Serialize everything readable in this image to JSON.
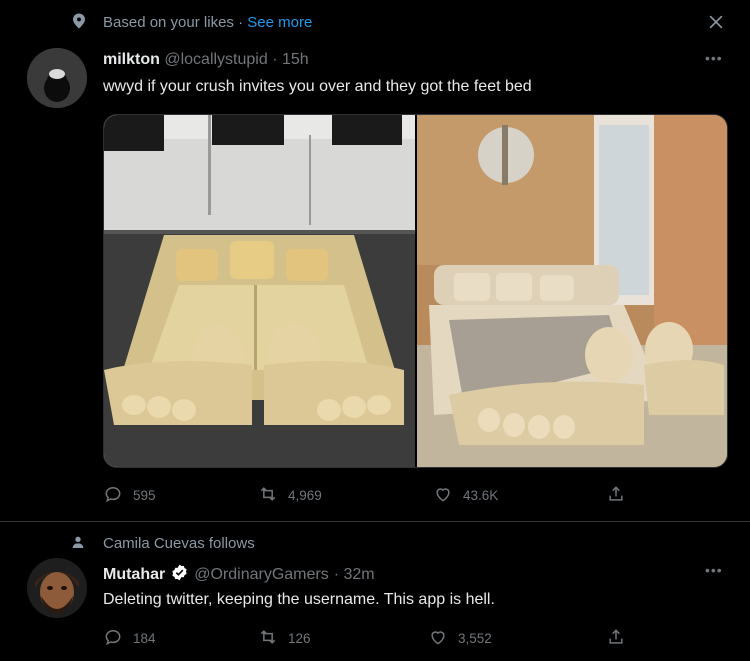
{
  "context_top": {
    "text": "Based on your likes",
    "separator": " · ",
    "link": "See more"
  },
  "tweet1": {
    "name": "milkton",
    "handle": "@locallystupid",
    "time": "· 15h",
    "text": "wwyd if your crush invites you over and they got the feet bed",
    "replies": "595",
    "retweets": "4,969",
    "likes": "43.6K"
  },
  "context_second": {
    "text": "Camila Cuevas follows"
  },
  "tweet2": {
    "name": "Mutahar",
    "handle": "@OrdinaryGamers",
    "time": "· 32m",
    "text": "Deleting twitter, keeping the username. This app is hell.",
    "replies": "184",
    "retweets": "126",
    "likes": "3,552"
  },
  "colors": {
    "background": "#000000",
    "accent": "#1d9bf0",
    "muted": "#71767b",
    "verified": "#ffffff"
  },
  "icons": [
    "location-pin-icon",
    "close-icon",
    "more-icon",
    "reply-icon",
    "retweet-icon",
    "like-icon",
    "share-icon",
    "person-icon",
    "verified-icon"
  ]
}
